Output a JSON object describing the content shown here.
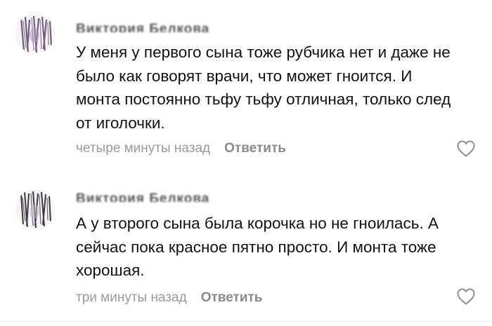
{
  "comments": [
    {
      "author": "Виктория Белкова",
      "text": "У меня у первого сына тоже рубчика нет и даже не было как говорят врачи, что может гноится. И монта постоянно тьфу тьфу отличная, только след от иголочки.",
      "time": "четыре минуты назад",
      "reply_label": "Ответить",
      "like_icon": "heart-outline-icon"
    },
    {
      "author": "Виктория Белкова",
      "text": "А у второго сына была корочка но не гноилась. А сейчас пока красное пятно просто. И монта тоже хорошая.",
      "time": "три минуты назад",
      "reply_label": "Ответить",
      "like_icon": "heart-outline-icon"
    }
  ],
  "colors": {
    "meta_text": "#9a9a9a",
    "reply_text": "#8a8a8a",
    "icon_stroke": "#8e8e8e"
  }
}
